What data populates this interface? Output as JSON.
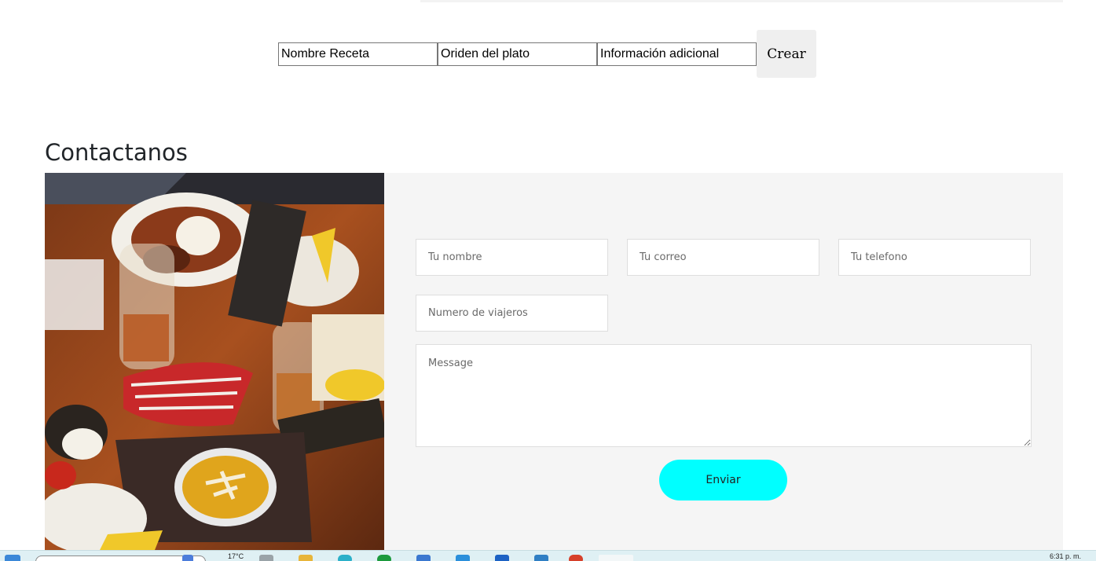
{
  "recipe_form": {
    "name_placeholder": "Nombre Receta",
    "order_placeholder": "Oriden del plato",
    "info_placeholder": "Información adicional",
    "create_label": "Crear"
  },
  "contact": {
    "title": "Contactanos",
    "name_placeholder": "Tu nombre",
    "email_placeholder": "Tu correo",
    "phone_placeholder": "Tu telefono",
    "travelers_placeholder": "Numero de viajeros",
    "message_placeholder": "Message",
    "send_label": "Enviar"
  },
  "taskbar": {
    "temperature": "17°C",
    "clock": "6:31 p. m."
  },
  "colors": {
    "send_button": "#00ffff",
    "panel_background": "#f5f5f5",
    "taskbar": "#dff0f4"
  },
  "icons": [
    "windows-start-icon",
    "search-icon",
    "weather-icon",
    "taskview-icon",
    "folder-icon",
    "edge-icon",
    "chrome-icon",
    "store-icon",
    "vscode-icon",
    "mail-icon",
    "app-icon",
    "browser-icon"
  ]
}
